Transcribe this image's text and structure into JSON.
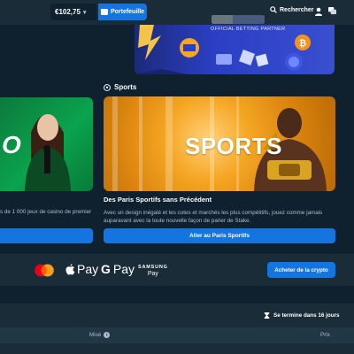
{
  "header": {
    "balance": "€102,75",
    "wallet_label": "Portefeuille",
    "search_label": "Rechercher"
  },
  "promo": {
    "partner_text": "OFFICIAL BETTING PARTNER"
  },
  "casino": {
    "hero_text": "O",
    "description": "s de 1 000 jeux de casino de premier"
  },
  "sports": {
    "section_title": "Sports",
    "card_text": "SPORTS",
    "heading": "Des Paris Sportifs sans Précédent",
    "description": "Avec un design inégalé et les cotes et marchés les plus compétitifs, jouez comme jamais auparavant avec la toute nouvelle façon de parier de Stake.",
    "button_label": "Aller au Paris Sportifs"
  },
  "payments": {
    "apple_pay": "Pay",
    "google_pay": "Pay",
    "google_g": "G",
    "samsung_brand": "SAMSUNG",
    "samsung_pay": "Pay",
    "buy_crypto_label": "Acheter de la crypto"
  },
  "race": {
    "ends_in": "Se termine dans 16 jours",
    "columns": {
      "stake": "Misé",
      "prize": "Prix"
    }
  },
  "colors": {
    "background": "#0f212e",
    "panel": "#1a2c38",
    "accent": "#1475e1",
    "muted_text": "#b1bad3"
  }
}
